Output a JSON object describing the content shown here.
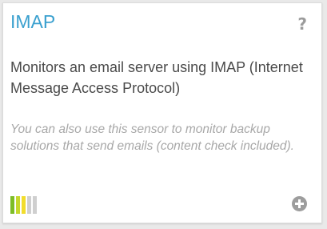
{
  "sensor": {
    "title": "IMAP",
    "help_label": "?",
    "description": "Monitors an email server using IMAP (Internet Message Access Protocol)",
    "note": "You can also use this sensor to monitor backup solutions that send emails (content check included).",
    "performance_icon": "performance-bars-icon",
    "add_icon": "plus-circle-icon",
    "performance_bars": [
      {
        "color": "#7dbd26"
      },
      {
        "color": "#c6d82c"
      },
      {
        "color": "#f2dd2c"
      },
      {
        "color": "#cfcfcf"
      },
      {
        "color": "#cfcfcf"
      }
    ]
  },
  "colors": {
    "title": "#3aa0cf",
    "icon_gray": "#9b9b9b"
  }
}
